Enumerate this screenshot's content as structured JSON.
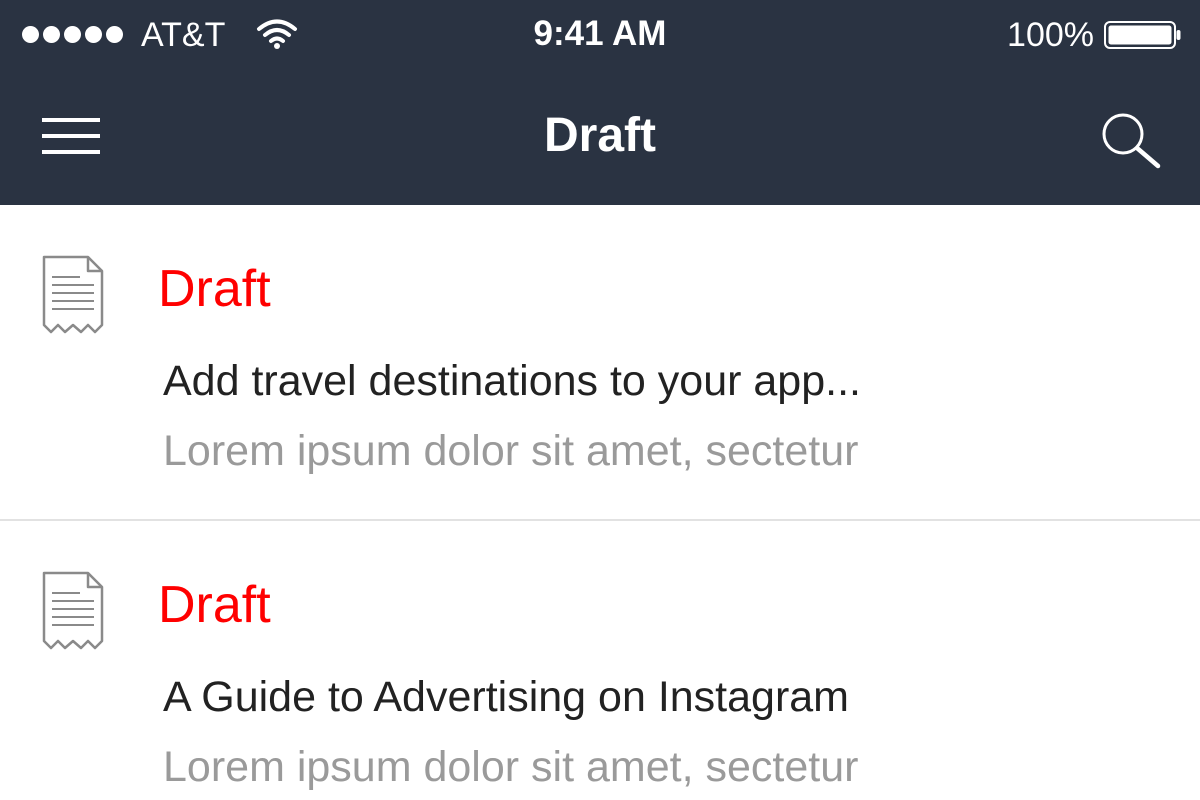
{
  "status_bar": {
    "carrier": "AT&T",
    "time": "9:41 AM",
    "battery_percent": "100%",
    "signal_icon": "signal-dots-icon",
    "wifi_icon": "wifi-icon",
    "battery_icon": "battery-full-icon"
  },
  "nav": {
    "title": "Draft",
    "menu_icon": "hamburger-menu-icon",
    "search_icon": "search-icon"
  },
  "colors": {
    "header_bg": "#2a3342",
    "status_accent": "#ff0000",
    "title_text": "#222222",
    "excerpt_text": "#9a9a9a",
    "divider": "#e2e2e2"
  },
  "items": [
    {
      "icon": "document-icon",
      "status": "Draft",
      "title": "Add travel destinations to your app...",
      "excerpt": "Lorem ipsum dolor sit amet, sectetur"
    },
    {
      "icon": "document-icon",
      "status": "Draft",
      "title": "A Guide to Advertising on Instagram",
      "excerpt": "Lorem ipsum dolor sit amet, sectetur"
    }
  ]
}
